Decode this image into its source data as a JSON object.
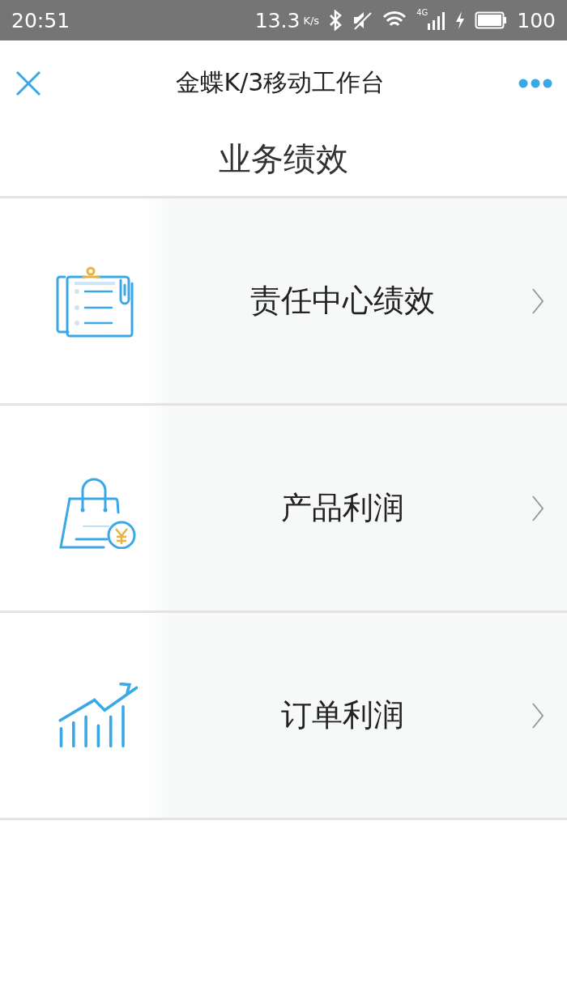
{
  "status_bar": {
    "time": "20:51",
    "speed": "13.3",
    "speed_unit": "K/s",
    "network": "4G",
    "battery": "100"
  },
  "header": {
    "title": "金蝶K/3移动工作台"
  },
  "page_title": "业务绩效",
  "items": [
    {
      "label": "责任中心绩效",
      "kind": "clipboard"
    },
    {
      "label": "产品利润",
      "kind": "bag"
    },
    {
      "label": "订单利润",
      "kind": "chart"
    }
  ]
}
